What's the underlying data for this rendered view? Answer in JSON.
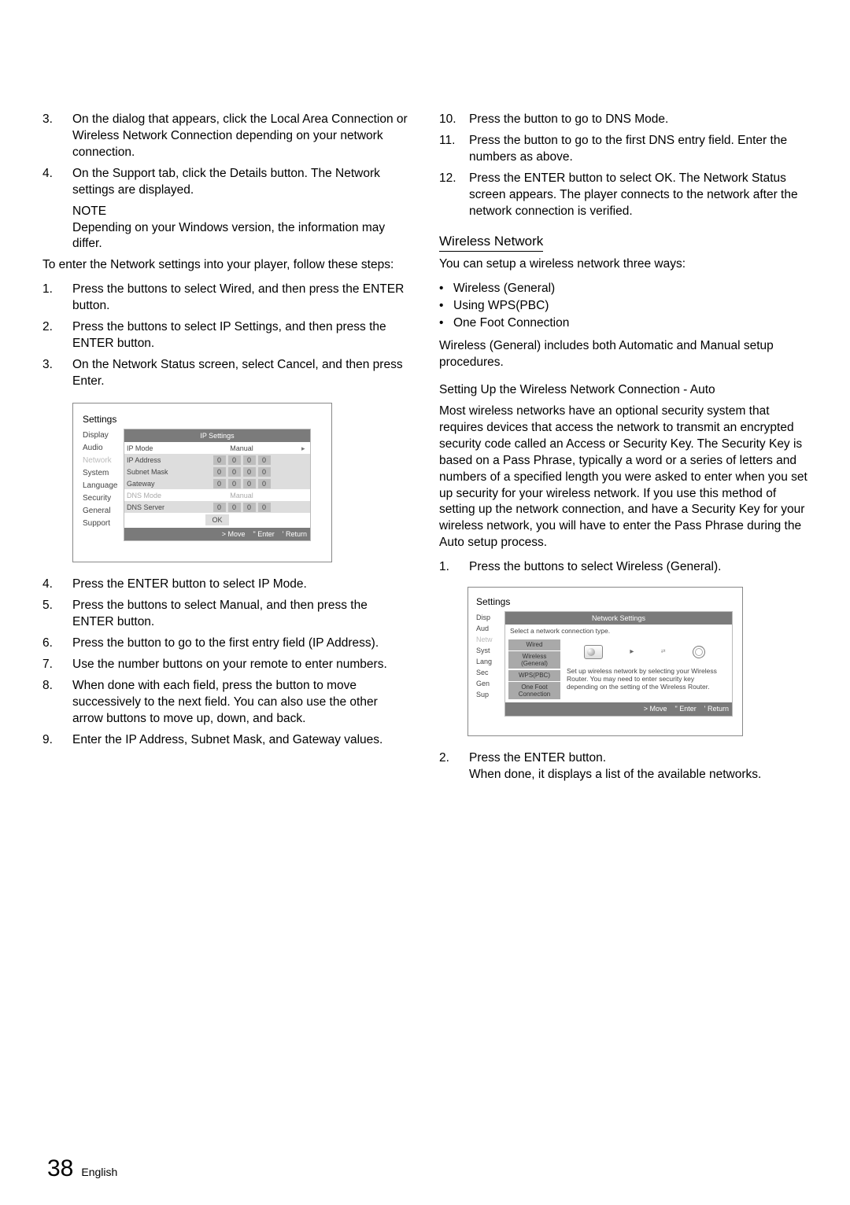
{
  "left": {
    "l3": "On the dialog that appears, click the Local Area Connection or Wireless Network Connection depending on your network connection.",
    "l4": "On the Support tab, click the Details button. The Network settings are displayed.",
    "note_label": "NOTE",
    "note_text": "Depending on your Windows version, the information may differ.",
    "intro": "To enter the Network settings into your player, follow these steps:",
    "s1": "Press the    buttons to select Wired, and then press the ENTER button.",
    "s2": "Press the    buttons to select IP Settings, and then press the ENTER button.",
    "s3": "On the Network Status screen, select Cancel, and then press Enter.",
    "s4": "Press the ENTER button to select IP Mode.",
    "s5": "Press the    buttons to select Manual, and then press the ENTER button.",
    "s6": "Press the    button to go to the first entry field (IP Address).",
    "s7": "Use the number buttons on your remote to enter numbers.",
    "s8": "When done with each field, press the    button to move successively to the next field. You can also use the other arrow buttons to move up, down, and back.",
    "s9": "Enter the IP Address, Subnet Mask, and Gateway values."
  },
  "right": {
    "r10": "Press the    button to go to DNS Mode.",
    "r11": "Press the    button to go to the first DNS entry field. Enter the numbers as above.",
    "r12": "Press the ENTER button to select OK. The Network Status screen appears. The player connects to the network after the network connection is verified.",
    "heading": "Wireless Network",
    "intro": "You can setup a wireless network three ways:",
    "b1": "Wireless (General)",
    "b2": "Using WPS(PBC)",
    "b3": "One Foot Connection",
    "after_bullets": "Wireless (General) includes both Automatic and Manual setup procedures.",
    "sub": "Setting Up the Wireless Network Connection - Auto",
    "big": "Most wireless networks have an optional security system that requires devices that access the network to transmit an encrypted security code called an Access or Security Key. The Security Key is based on a Pass Phrase, typically a word or a series of letters and numbers of a specified length you were asked to enter when you set up security for your wireless network. If you use this method of setting up the network connection, and have a Security Key for your wireless network, you will have to enter the Pass Phrase during the Auto setup process.",
    "w1": "Press the    buttons to select Wireless (General).",
    "w2": "Press the ENTER button.\nWhen done, it displays a list of the available networks."
  },
  "ip_panel": {
    "settings": "Settings",
    "menu": [
      "Display",
      "Audio",
      "Network",
      "System",
      "Language",
      "Security",
      "General",
      "Support"
    ],
    "header": "IP Settings",
    "ip_mode_label": "IP Mode",
    "ip_mode_value": "Manual",
    "ip_address": "IP Address",
    "subnet": "Subnet Mask",
    "gateway": "Gateway",
    "dns_mode_label": "DNS Mode",
    "dns_mode_value": "Manual",
    "dns_server": "DNS Server",
    "ok": "OK",
    "footer_move": "Move",
    "footer_enter": "Enter",
    "footer_return": "Return",
    "seg": "0"
  },
  "net_panel": {
    "settings": "Settings",
    "menu": [
      "Disp",
      "Aud",
      "Netw",
      "Syst",
      "Lang",
      "Sec",
      "Gen",
      "Sup"
    ],
    "header": "Network Settings",
    "hint": "Select a network connection type.",
    "opt_wired": "Wired",
    "opt_wireless": "Wireless\n(General)",
    "opt_wps": "WPS(PBC)",
    "opt_onefoot": "One Foot\nConnection",
    "desc": "Set up wireless network by selecting your Wireless Router. You may need to enter security key depending on the setting of the Wireless Router.",
    "footer_move": "Move",
    "footer_enter": "Enter",
    "footer_return": "Return"
  },
  "footer": {
    "num": "38",
    "lang": "English"
  }
}
